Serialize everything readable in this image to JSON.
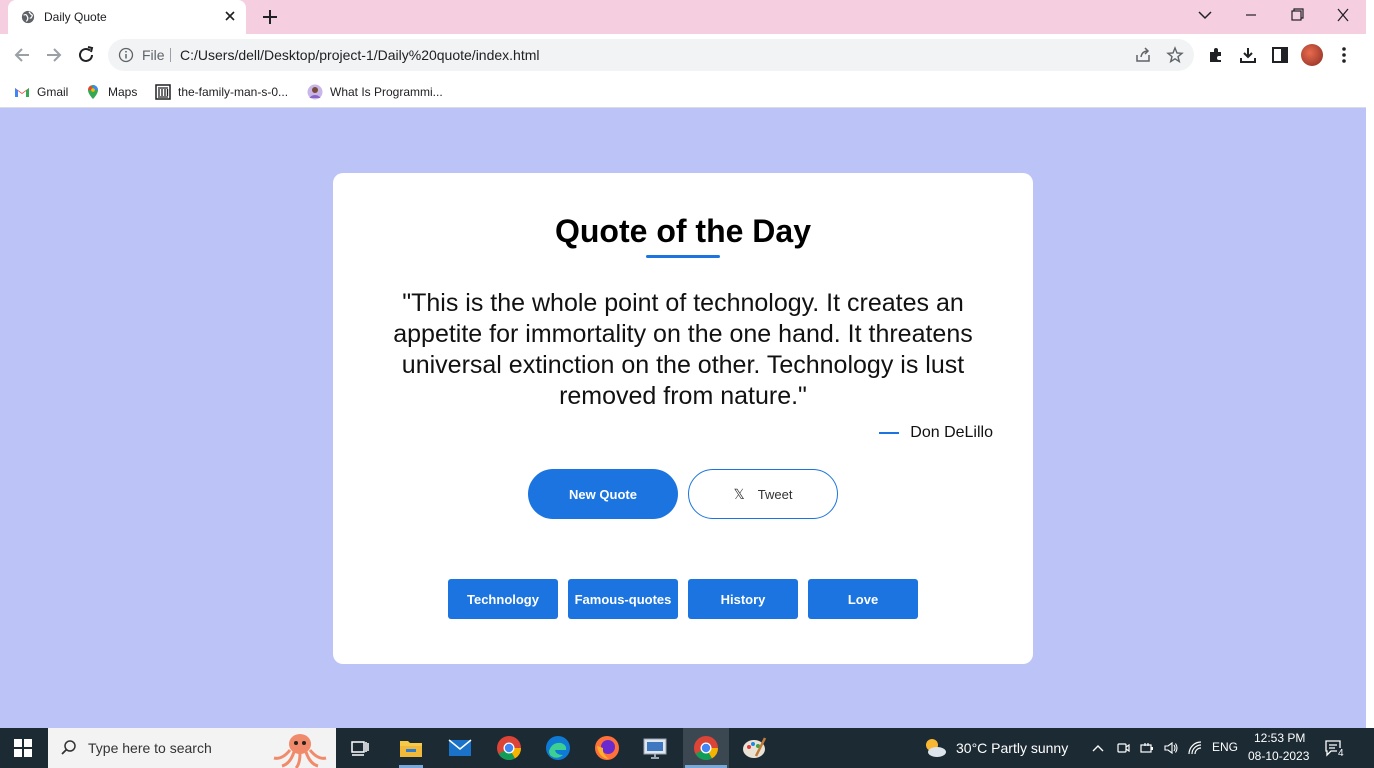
{
  "browser": {
    "tab_title": "Daily Quote",
    "omnibox_label": "File",
    "url": "C:/Users/dell/Desktop/project-1/Daily%20quote/index.html",
    "bookmarks": [
      {
        "label": "Gmail",
        "icon": "gmail-icon"
      },
      {
        "label": "Maps",
        "icon": "maps-icon"
      },
      {
        "label": "the-family-man-s-0...",
        "icon": "bookmark-building-icon"
      },
      {
        "label": "What Is Programmi...",
        "icon": "bookmark-avatar-icon"
      }
    ]
  },
  "page": {
    "title": "Quote of the Day",
    "quote": "\"This is the whole point of technology. It creates an appetite for immortality on the one hand. It threatens universal extinction on the other. Technology is lust removed from nature.\"",
    "author": "Don DeLillo",
    "new_quote_label": "New Quote",
    "tweet_label": "Tweet",
    "categories": [
      "Technology",
      "Famous-quotes",
      "History",
      "Love"
    ],
    "colors": {
      "accent": "#1b74e0",
      "background": "#bbc3f7",
      "card": "#ffffff"
    }
  },
  "taskbar": {
    "search_placeholder": "Type here to search",
    "weather": "30°C  Partly sunny",
    "language": "ENG",
    "time": "12:53 PM",
    "date": "08-10-2023",
    "notification_count": "4"
  }
}
